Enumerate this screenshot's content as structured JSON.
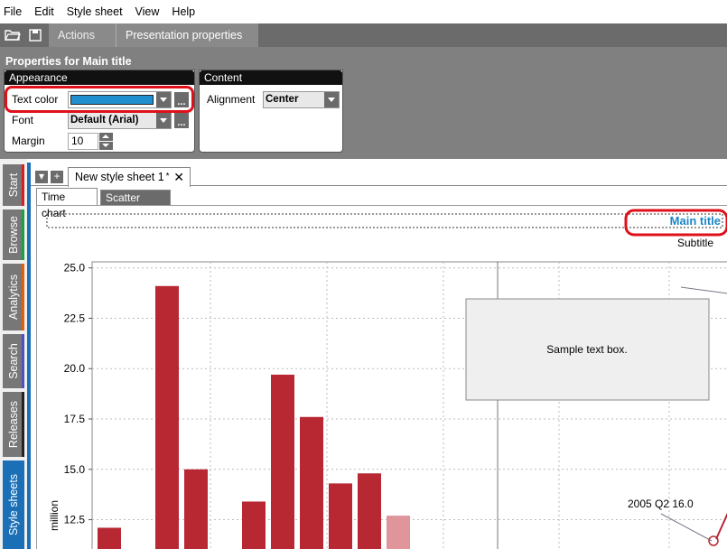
{
  "menu": [
    "File",
    "Edit",
    "Style sheet",
    "View",
    "Help"
  ],
  "toolbar": {
    "open_icon": "folder-open-icon",
    "save_icon": "save-icon",
    "tabs": [
      "Actions",
      "Presentation properties"
    ]
  },
  "properties": {
    "title": "Properties for Main title",
    "appearance": {
      "header": "Appearance",
      "text_color_label": "Text color",
      "text_color_value": "#1f8fd0",
      "font_label": "Font",
      "font_value": "Default (Arial)",
      "margin_label": "Margin",
      "margin_value": "10"
    },
    "content": {
      "header": "Content",
      "alignment_label": "Alignment",
      "alignment_value": "Center"
    }
  },
  "sidebar": {
    "tabs": [
      {
        "label": "Start",
        "accent": "#d42020"
      },
      {
        "label": "Browse",
        "accent": "#1e9e40"
      },
      {
        "label": "Analytics",
        "accent": "#e06010"
      },
      {
        "label": "Search",
        "accent": "#5050c0"
      },
      {
        "label": "Releases",
        "accent": "#222222"
      },
      {
        "label": "Style sheets",
        "accent": "#1a6fb6"
      }
    ]
  },
  "document": {
    "tab_label": "New style sheet 1",
    "modified_mark": "*",
    "close": "✕",
    "chart_tabs": [
      "Time chart",
      "Scatter chart"
    ]
  },
  "chart": {
    "main_title": "Main title",
    "subtitle": "Subtitle",
    "text_box": "Sample text box.",
    "annotation": "2005 Q2 16.0",
    "colors": {
      "bar": "#b72833",
      "bar_light": "#e0959b",
      "title": "#1a86c8"
    }
  },
  "chart_data": {
    "type": "bar",
    "title": "Main title",
    "subtitle": "Subtitle",
    "ylabel": "million",
    "yticks": [
      "25.0",
      "22.5",
      "20.0",
      "17.5",
      "15.0",
      "12.5"
    ],
    "ylim": [
      11,
      25.3
    ],
    "values": [
      12.1,
      11.0,
      24.1,
      15.0,
      11.0,
      13.4,
      19.7,
      17.6,
      14.3,
      14.8,
      12.7
    ],
    "highlighted_last": true,
    "grid": true
  }
}
